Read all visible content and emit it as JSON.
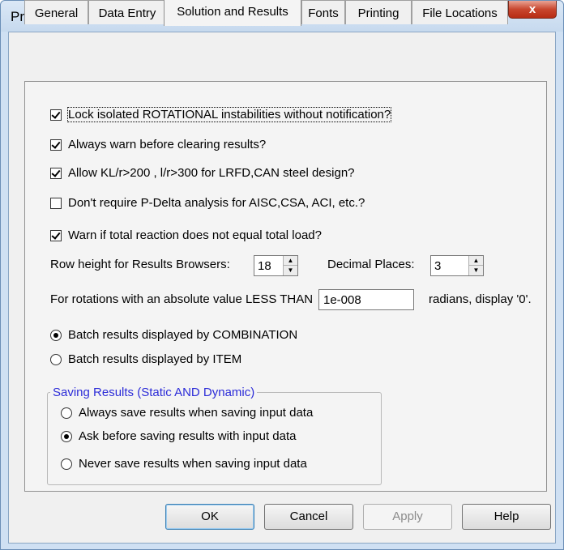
{
  "window": {
    "title": "Preferences",
    "close_label": "x"
  },
  "tabs": [
    {
      "label": "General",
      "active": false
    },
    {
      "label": "Data Entry",
      "active": false
    },
    {
      "label": "Solution and Results",
      "active": true
    },
    {
      "label": "Fonts",
      "active": false
    },
    {
      "label": "Printing",
      "active": false
    },
    {
      "label": "File Locations",
      "active": false
    }
  ],
  "options": {
    "lock_rotational": {
      "label": "Lock isolated ROTATIONAL instabilities without notification?",
      "checked": true
    },
    "warn_clearing": {
      "label": "Always warn before clearing results?",
      "checked": true
    },
    "allow_klr": {
      "label": "Allow KL/r>200 , l/r>300 for LRFD,CAN steel design?",
      "checked": true
    },
    "no_pdelta": {
      "label": "Don't require P-Delta analysis for AISC,CSA, ACI, etc.?",
      "checked": false
    },
    "warn_reaction": {
      "label": "Warn if total reaction does not equal total load?",
      "checked": true
    }
  },
  "row_height": {
    "label": "Row height for Results Browsers:",
    "value": "18"
  },
  "decimal_places": {
    "label": "Decimal Places:",
    "value": "3"
  },
  "rotations": {
    "label_before": "For rotations with an absolute value LESS THAN",
    "value": "1e-008",
    "label_after": "radians, display '0'."
  },
  "batch": {
    "by_combination": {
      "label": "Batch results displayed by COMBINATION",
      "selected": true
    },
    "by_item": {
      "label": "Batch results displayed by ITEM",
      "selected": false
    }
  },
  "saving": {
    "title": "Saving Results (Static AND Dynamic)",
    "always": {
      "label": "Always save results when saving input data",
      "selected": false
    },
    "ask": {
      "label": "Ask before saving results with input data",
      "selected": true
    },
    "never": {
      "label": "Never save results when saving input data",
      "selected": false
    }
  },
  "buttons": {
    "ok": "OK",
    "cancel": "Cancel",
    "apply": "Apply",
    "help": "Help"
  },
  "colors": {
    "group_title": "#2c2cd8",
    "close_button": "#c8462e"
  }
}
